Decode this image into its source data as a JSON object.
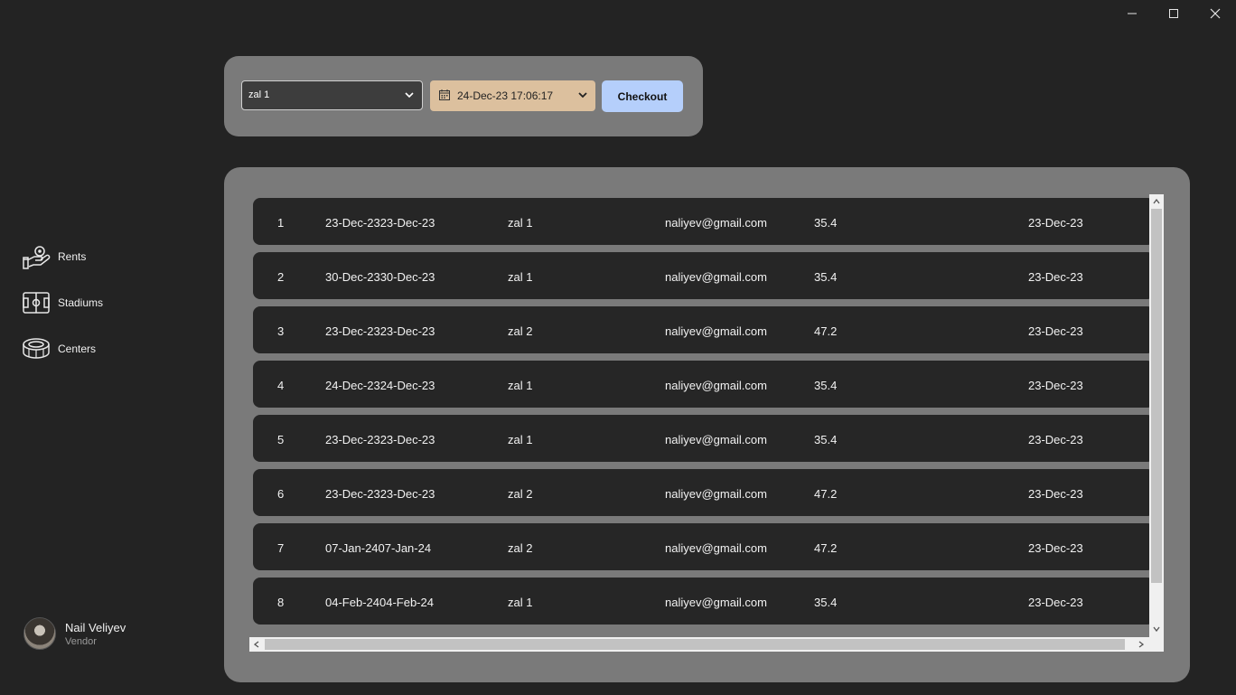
{
  "sidebar": {
    "items": [
      {
        "label": "Rents",
        "icon": "hand-coin-icon"
      },
      {
        "label": "Stadiums",
        "icon": "stadium-field-icon"
      },
      {
        "label": "Centers",
        "icon": "arena-icon"
      }
    ]
  },
  "user": {
    "name": "Nail Veliyev",
    "role": "Vendor"
  },
  "filters": {
    "hall_selected": "zal 1",
    "date_value": "24-Dec-23 17:06:17",
    "checkout_label": "Checkout"
  },
  "colors": {
    "background": "#232323",
    "panel": "#7a7a7a",
    "row": "#262626",
    "date_picker": "#dcc09e",
    "checkout_button": "#b5cffb"
  },
  "rents": [
    {
      "id": "1",
      "dates": "23-Dec-2323-Dec-23",
      "hall": "zal 1",
      "email": "naliyev@gmail.com",
      "price": "35.4",
      "created": "23-Dec-23"
    },
    {
      "id": "2",
      "dates": "30-Dec-2330-Dec-23",
      "hall": "zal 1",
      "email": "naliyev@gmail.com",
      "price": "35.4",
      "created": "23-Dec-23"
    },
    {
      "id": "3",
      "dates": "23-Dec-2323-Dec-23",
      "hall": "zal 2",
      "email": "naliyev@gmail.com",
      "price": "47.2",
      "created": "23-Dec-23"
    },
    {
      "id": "4",
      "dates": "24-Dec-2324-Dec-23",
      "hall": "zal 1",
      "email": "naliyev@gmail.com",
      "price": "35.4",
      "created": "23-Dec-23"
    },
    {
      "id": "5",
      "dates": "23-Dec-2323-Dec-23",
      "hall": "zal 1",
      "email": "naliyev@gmail.com",
      "price": "35.4",
      "created": "23-Dec-23"
    },
    {
      "id": "6",
      "dates": "23-Dec-2323-Dec-23",
      "hall": "zal 2",
      "email": "naliyev@gmail.com",
      "price": "47.2",
      "created": "23-Dec-23"
    },
    {
      "id": "7",
      "dates": "07-Jan-2407-Jan-24",
      "hall": "zal 2",
      "email": "naliyev@gmail.com",
      "price": "47.2",
      "created": "23-Dec-23"
    },
    {
      "id": "8",
      "dates": "04-Feb-2404-Feb-24",
      "hall": "zal 1",
      "email": "naliyev@gmail.com",
      "price": "35.4",
      "created": "23-Dec-23"
    }
  ]
}
